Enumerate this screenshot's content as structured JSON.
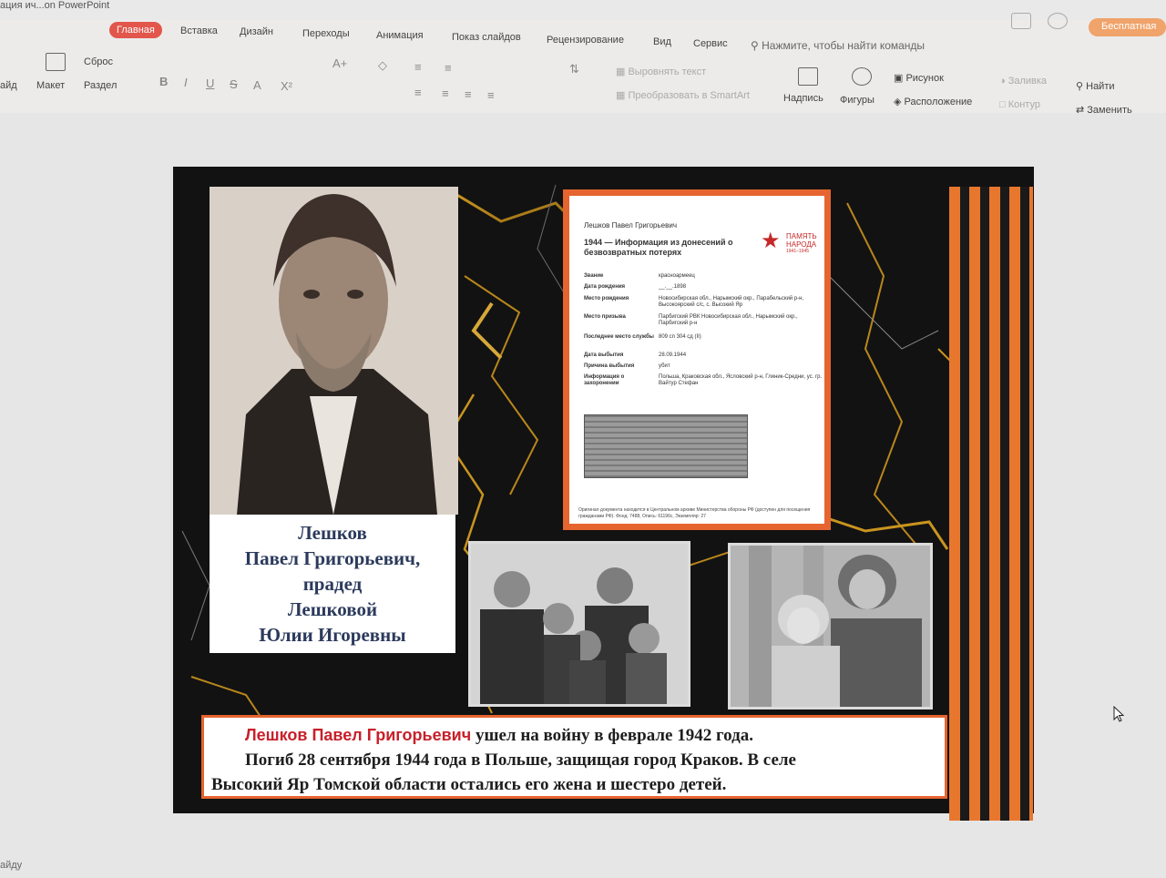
{
  "window": {
    "title": "ация ич...on PowerPoint",
    "trial_label": "Бесплатная"
  },
  "ribbon": {
    "tabs": [
      "Главная",
      "Вставка",
      "Дизайн",
      "Переходы",
      "Анимация",
      "Показ слайдов",
      "Рецензирование",
      "Вид",
      "Сервис"
    ],
    "active_tab": "Главная",
    "search_placeholder": "Нажмите, чтобы найти команды",
    "buttons": {
      "reset": "Сброс",
      "layout": "Макет",
      "section": "Раздел",
      "slide_partial": "айд",
      "align_text": "Выровнять текст",
      "smartart": "Преобразовать в SmartArt",
      "textbox": "Надпись",
      "shapes": "Фигуры",
      "picture": "Рисунок",
      "arrange": "Расположение",
      "fill": "Заливка",
      "outline": "Контур",
      "find": "Найти",
      "replace": "Заменить"
    }
  },
  "slide": {
    "caption": {
      "line1": "Лешков",
      "line2": "Павел Григорьевич,",
      "line3": "прадед",
      "line4": "Лешковой",
      "line5": "Юлии Игоревны"
    },
    "document": {
      "person": "Лешков Павел Григорьевич",
      "heading": "1944 — Информация из донесений о безвозвратных потерях",
      "logo_text": "ПАМЯТЬ НАРОДА",
      "logo_years": "1941–1945",
      "fields": [
        {
          "label": "Звание",
          "value": "красноармеец"
        },
        {
          "label": "Дата рождения",
          "value": "__.__.1898"
        },
        {
          "label": "Место рождения",
          "value": "Новосибирская обл., Нарымский окр., Парабельский р-н, Высокоярский с/с, с. Высокий Яр"
        },
        {
          "label": "Место призыва",
          "value": "Парбигский РВК Новосибирская обл., Нарымский окр., Парбигский р-н"
        },
        {
          "label": "Последнее место службы",
          "value": "809 сп 304 сд (II)"
        },
        {
          "label": "Дата выбытия",
          "value": "28.09.1944"
        },
        {
          "label": "Причина выбытия",
          "value": "убит"
        },
        {
          "label": "Информация о захоронении",
          "value": "Польша, Краковская обл., Ясловский р-н, Глиник-Средни, ус. гр. Вайтур Стефан"
        }
      ],
      "footnote": "Оригинал документа находится в Центральном архиве Министерства обороны РФ (доступен для посещения гражданами РФ). Фонд: 7488, Опись: 61196с, Экземпляр: 27"
    },
    "bottom": {
      "name": "Лешков Павел Григорьевич",
      "line1_rest": " ушел на войну в феврале 1942 года.",
      "line2": "Погиб 28 сентября 1944 года в Польше, защищая город Краков. В селе",
      "line3": "Высокий Яр Томской области остались его жена и шестеро детей."
    }
  },
  "status": {
    "left": "айду"
  },
  "colors": {
    "accent_red": "#e2564b",
    "ribbon_orange": "#e8772e",
    "caption_blue": "#2b3a5c",
    "name_red": "#c8202a"
  }
}
